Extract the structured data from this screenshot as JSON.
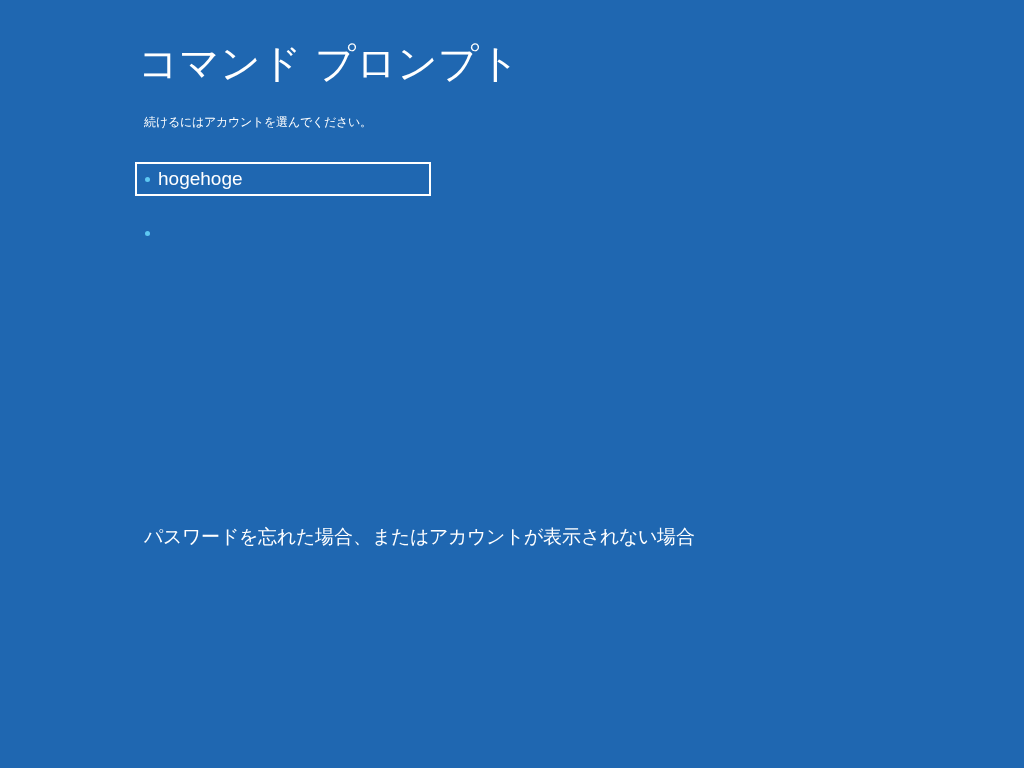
{
  "title": "コマンド プロンプト",
  "instruction": "続けるにはアカウントを選んでください。",
  "accounts": [
    {
      "name": "hogehoge",
      "selected": true
    },
    {
      "selected": false
    }
  ],
  "help_link": "パスワードを忘れた場合、またはアカウントが表示されない場合"
}
